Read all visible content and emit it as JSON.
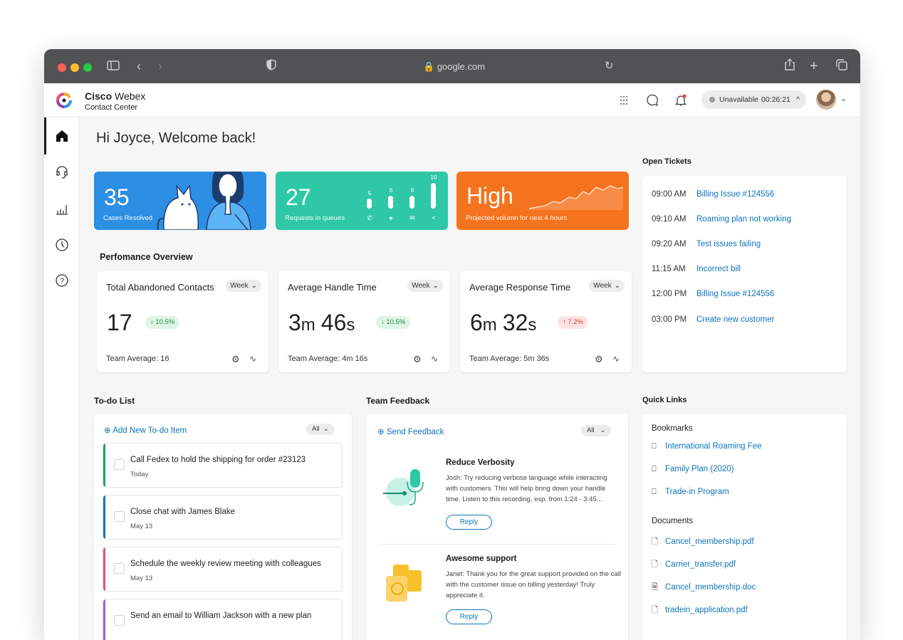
{
  "browser": {
    "url": "google.com"
  },
  "app": {
    "brand_bold": "Cisco",
    "brand_light": "Webex",
    "brand_sub": "Contact Center"
  },
  "header": {
    "status": "Unavailable",
    "timer": "00:26:21",
    "status_chevron": "^",
    "avatar_chevron": "⌄"
  },
  "greeting": "Hi Joyce, Welcome back!",
  "tiles": {
    "cases": {
      "value": "35",
      "label": "Cases Resolved",
      "color": "#2d8fe3"
    },
    "queues": {
      "value": "27",
      "label": "Requests in queues",
      "color": "#2ec8a6",
      "bars": [
        {
          "count": "5",
          "level": 0.35,
          "icon": "phone-icon"
        },
        {
          "count": "6",
          "level": 0.45,
          "icon": "chat-icon"
        },
        {
          "count": "6",
          "level": 0.45,
          "icon": "mail-icon"
        },
        {
          "count": "10",
          "level": 0.9,
          "icon": "share-icon"
        }
      ]
    },
    "volume": {
      "value": "High",
      "label": "Projected volumn for next 4 hours",
      "color": "#f5731f"
    }
  },
  "performance": {
    "title": "Perfomance Overview",
    "cards": [
      {
        "title": "Total Abandoned Contacts",
        "period": "Week",
        "value": "17",
        "unit1": "",
        "value2": "",
        "unit2": "",
        "delta": "↓ 10.5%",
        "delta_dir": "down",
        "average": "Team Average: 16"
      },
      {
        "title": "Average Handle Time",
        "period": "Week",
        "value": "3",
        "unit1": "m",
        "value2": "46",
        "unit2": "s",
        "delta": "↓ 10.5%",
        "delta_dir": "down",
        "average": "Team Average: 4m 16s"
      },
      {
        "title": "Average Response Time",
        "period": "Week",
        "value": "6",
        "unit1": "m",
        "value2": "32",
        "unit2": "s",
        "delta": "↑ 7.2%",
        "delta_dir": "up",
        "average": "Team Average: 5m 36s"
      }
    ]
  },
  "open_tickets": {
    "title": "Open Tickets",
    "items": [
      {
        "time": "09:00 AM",
        "label": "Billing Issue #124556"
      },
      {
        "time": "09:10 AM",
        "label": "Roaming plan not working"
      },
      {
        "time": "09:20 AM",
        "label": "Test issues failing"
      },
      {
        "time": "11:15 AM",
        "label": "Incorrect bill"
      },
      {
        "time": "12:00 PM",
        "label": "Billing Issue #124556"
      },
      {
        "time": "03:00 PM",
        "label": "Create new customer"
      }
    ]
  },
  "todo": {
    "title": "To-do List",
    "add_label": "Add New To-do Item",
    "filter": "All",
    "items": [
      {
        "text": "Call Fedex to hold the shipping for order #23123",
        "date": "Today",
        "color": "#1aa65a"
      },
      {
        "text": "Close chat with James Blake",
        "date": "May 13",
        "color": "#1672c9"
      },
      {
        "text": "Schedule the weekly review meeting with colleagues",
        "date": "May 13",
        "color": "#e8506b"
      },
      {
        "text": "Send an email to William Jackson with a new plan",
        "date": "",
        "color": "#9b5de5"
      }
    ]
  },
  "feedback": {
    "title": "Team Feedback",
    "send_label": "Send Feedback",
    "filter": "All",
    "items": [
      {
        "title": "Reduce Verbosity",
        "body": "Josh: Try reducing verbose language while interacting with customers. This will help bring down your handle time. Listen to this recording, esp. from 1:24 - 3:45...",
        "reply": "Reply"
      },
      {
        "title": "Awesome support",
        "body": "Janet: Thank you for the great support provided on the call with the customer issue on billing yesterday! Truly appreciate it.",
        "reply": "Reply"
      }
    ]
  },
  "quick_links": {
    "title": "Quick Links",
    "bookmarks_label": "Bookmarks",
    "bookmarks": [
      "International Roaming Fee",
      "Family Plan (2020)",
      "Trade-in Program"
    ],
    "documents_label": "Documents",
    "documents": [
      {
        "name": "Cancel_membership.pdf",
        "icon": "pdf-icon"
      },
      {
        "name": "Carrier_transfer.pdf",
        "icon": "pdf-icon"
      },
      {
        "name": "Cancel_membership.doc",
        "icon": "doc-icon"
      },
      {
        "name": "tradein_application.pdf",
        "icon": "pdf-icon"
      }
    ]
  },
  "colors": {
    "link": "#0f74b8",
    "delta_down_bg": "#dff5e6",
    "delta_down_fg": "#1a8a47",
    "delta_up_bg": "#fde4e4",
    "delta_up_fg": "#d03a3a"
  }
}
